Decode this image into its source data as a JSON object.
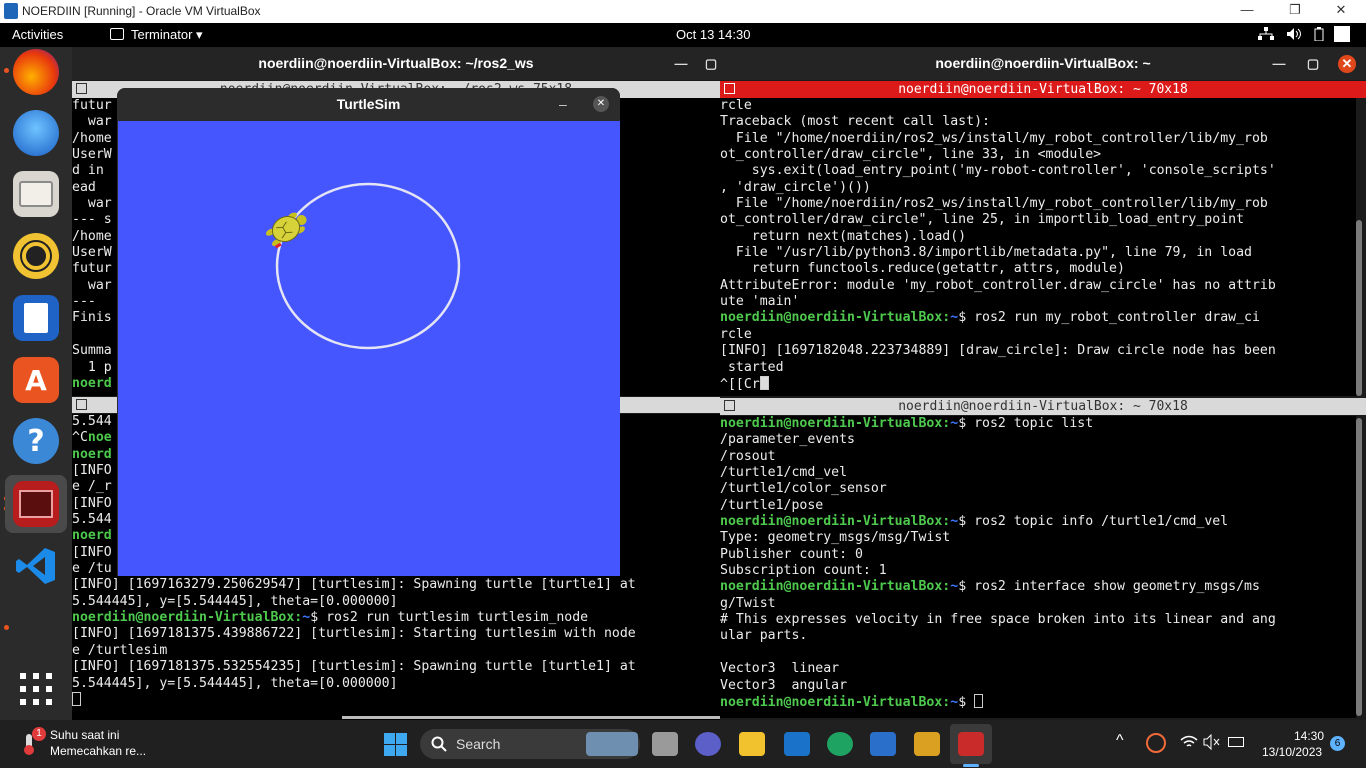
{
  "host": {
    "title": "NOERDIIN [Running] - Oracle VM VirtualBox",
    "min": "—",
    "max": "❐",
    "close": "✕"
  },
  "topbar": {
    "activities": "Activities",
    "app": "Terminator ▾",
    "clock": "Oct 13  14:30",
    "tray": [
      "network-icon",
      "volume-icon",
      "battery-icon"
    ]
  },
  "dock": {
    "apps": [
      "firefox-icon",
      "thunderbird-icon",
      "files-icon",
      "rhythmbox-icon",
      "writer-icon",
      "app-center-icon",
      "help-icon",
      "terminator-icon",
      "vscode-icon"
    ],
    "grid_label": "⋮⋮⋮"
  },
  "left_window": {
    "title": "noerdiin@noerdiin-VirtualBox: ~/ros2_ws",
    "top_pane_title": "noerdiin@noerdiin-VirtualBox: ~/ros2_ws 75x18",
    "min": "—",
    "close": "▢"
  },
  "left_top_lines": [
    {
      "t": "futur                                             instead"
    },
    {
      "t": "  war"
    },
    {
      "t": "/home                                             s/dist.py:71"
    },
    {
      "t": "UserW                                             not be suppo"
    },
    {
      "t": "d in                                              _scripts' i"
    },
    {
      "t": "ead"
    },
    {
      "t": "  war"
    },
    {
      "t": "--- s"
    },
    {
      "t": "/home                                             s/dist.py:71"
    },
    {
      "t": "UserW                                             e supported"
    },
    {
      "t": "futur                                             instead"
    },
    {
      "t": "  war"
    },
    {
      "t": "---"
    },
    {
      "t": "Finis"
    },
    {
      "t": ""
    },
    {
      "t": "Summa"
    },
    {
      "t": "  1 p"
    },
    {
      "t": "noerd",
      "g": true
    }
  ],
  "left_bottom_lines": [
    {
      "t": "5.544"
    },
    {
      "t": "^C",
      "gtail": "noe"
    },
    {
      "t": "noerd                                             im_node",
      "g": true
    },
    {
      "t": "[INFO                                             n with node"
    },
    {
      "t": "e /_r"
    },
    {
      "t": "[INFO                                             turtle1] at"
    },
    {
      "t": "5.544"
    },
    {
      "t": "noerd                                             im_node",
      "g": true
    },
    {
      "t": "[INFO                                             n with node"
    },
    {
      "t": "e /tu"
    },
    {
      "t": "[INFO] [1697163279.250629547] [turtlesim]: Spawning turtle [turtle1] at"
    },
    {
      "t": "5.544445], y=[5.544445], theta=[0.000000]"
    },
    {
      "prompt": "noerdiin@noerdiin-VirtualBox",
      "path": "~",
      "cmd": "$ ros2 run turtlesim turtlesim_node"
    },
    {
      "t": "[INFO] [1697181375.439886722] [turtlesim]: Starting turtlesim with node"
    },
    {
      "t": "e /turtlesim"
    },
    {
      "t": "[INFO] [1697181375.532554235] [turtlesim]: Spawning turtle [turtle1] at"
    },
    {
      "t": "5.544445], y=[5.544445], theta=[0.000000]"
    },
    {
      "cursor": true
    }
  ],
  "turtlesim": {
    "title": "TurtleSim",
    "min": "–",
    "close": "✕",
    "pen_color": "#e4e4f4",
    "bg_color": "#4556ff"
  },
  "right_window": {
    "title": "noerdiin@noerdiin-VirtualBox: ~",
    "top_pane_title": "noerdiin@noerdiin-VirtualBox: ~ 70x18",
    "bottom_pane_title": "noerdiin@noerdiin-VirtualBox: ~ 70x18",
    "min": "—",
    "max": "▢",
    "close": "✕"
  },
  "right_top_lines": [
    {
      "t": "rcle"
    },
    {
      "t": "Traceback (most recent call last):"
    },
    {
      "t": "  File \"/home/noerdiin/ros2_ws/install/my_robot_controller/lib/my_rob"
    },
    {
      "t": "ot_controller/draw_circle\", line 33, in <module>"
    },
    {
      "t": "    sys.exit(load_entry_point('my-robot-controller', 'console_scripts'"
    },
    {
      "t": ", 'draw_circle')())"
    },
    {
      "t": "  File \"/home/noerdiin/ros2_ws/install/my_robot_controller/lib/my_rob"
    },
    {
      "t": "ot_controller/draw_circle\", line 25, in importlib_load_entry_point"
    },
    {
      "t": "    return next(matches).load()"
    },
    {
      "t": "  File \"/usr/lib/python3.8/importlib/metadata.py\", line 79, in load"
    },
    {
      "t": "    return functools.reduce(getattr, attrs, module)"
    },
    {
      "t": "AttributeError: module 'my_robot_controller.draw_circle' has no attrib"
    },
    {
      "t": "ute 'main'"
    },
    {
      "prompt": "noerdiin@noerdiin-VirtualBox",
      "path": "~",
      "cmd": "$ ros2 run my_robot_controller draw_ci"
    },
    {
      "t": "rcle"
    },
    {
      "t": "[INFO] [1697182048.223734889] [draw_circle]: Draw circle node has been"
    },
    {
      "t": " started"
    },
    {
      "t": "^[[Cr",
      "cursorfill": true
    }
  ],
  "right_bottom_lines": [
    {
      "prompt": "noerdiin@noerdiin-VirtualBox",
      "path": "~",
      "cmd": "$ ros2 topic list"
    },
    {
      "t": "/parameter_events"
    },
    {
      "t": "/rosout"
    },
    {
      "t": "/turtle1/cmd_vel"
    },
    {
      "t": "/turtle1/color_sensor"
    },
    {
      "t": "/turtle1/pose"
    },
    {
      "prompt": "noerdiin@noerdiin-VirtualBox",
      "path": "~",
      "cmd": "$ ros2 topic info /turtle1/cmd_vel"
    },
    {
      "t": "Type: geometry_msgs/msg/Twist"
    },
    {
      "t": "Publisher count: 0"
    },
    {
      "t": "Subscription count: 1"
    },
    {
      "prompt": "noerdiin@noerdiin-VirtualBox",
      "path": "~",
      "cmd": "$ ros2 interface show geometry_msgs/ms"
    },
    {
      "t": "g/Twist"
    },
    {
      "t": "# This expresses velocity in free space broken into its linear and ang"
    },
    {
      "t": "ular parts."
    },
    {
      "t": ""
    },
    {
      "t": "Vector3  linear"
    },
    {
      "t": "Vector3  angular"
    },
    {
      "prompt": "noerdiin@noerdiin-VirtualBox",
      "path": "~",
      "cmd": "$ ",
      "cursor": true
    }
  ],
  "taskbar": {
    "weather_title": "Suhu saat ini",
    "weather_sub": "Memecahkan re...",
    "weather_badge": "1",
    "search_placeholder": "Search",
    "time": "14:30",
    "date": "13/10/2023",
    "notif_count": "6",
    "tray_chevron": "^"
  }
}
